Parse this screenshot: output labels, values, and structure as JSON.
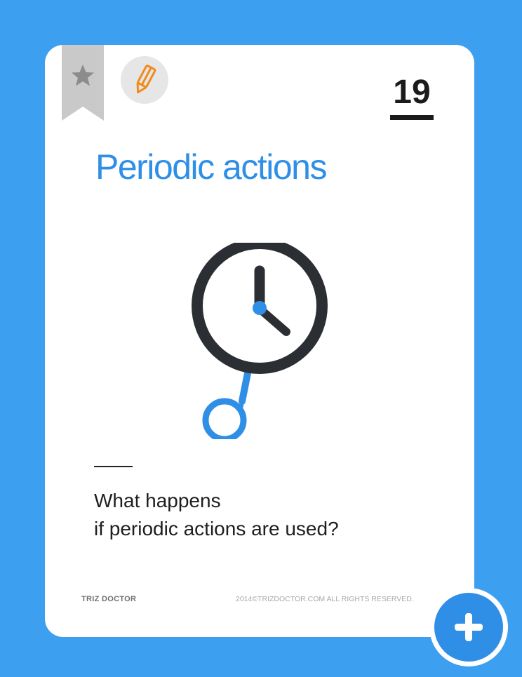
{
  "card": {
    "number": "19",
    "title": "Periodic actions",
    "question_line1": "What happens",
    "question_line2": "if periodic actions are used?",
    "brand": "TRIZ DOCTOR",
    "copyright": "2014©TRIZDOCTOR.COM  ALL RIGHTS RESERVED."
  },
  "icons": {
    "bookmark": "star-bookmark-icon",
    "edit": "pencil-icon",
    "illustration": "clock-pendulum-icon",
    "fab": "plus-icon"
  },
  "colors": {
    "background": "#3c9ff0",
    "accent": "#2f8fe6",
    "pencil": "#f08a1c",
    "clock": "#2b2f33",
    "bookmark": "#c9c9c9"
  }
}
